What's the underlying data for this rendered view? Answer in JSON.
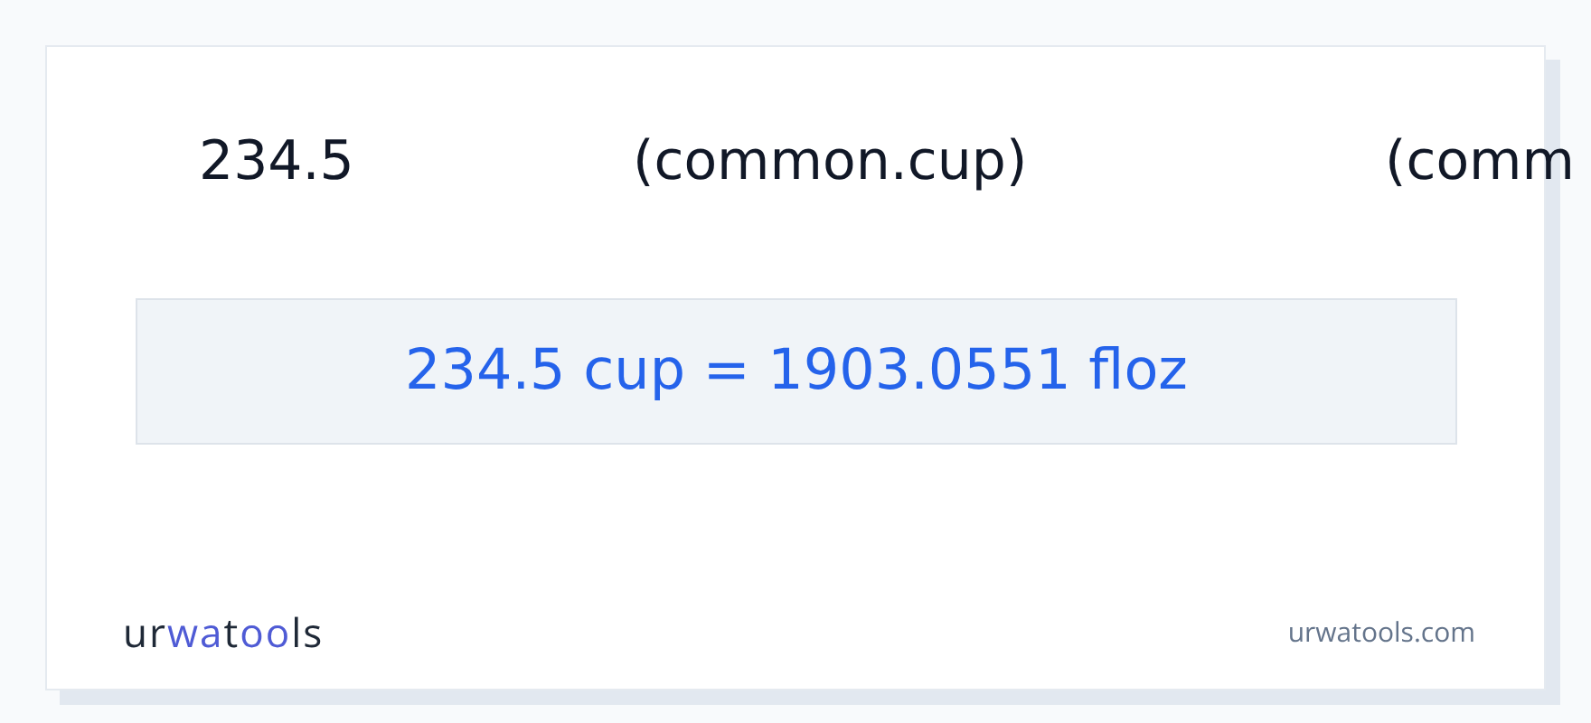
{
  "header_row": [
    "234.5",
    "(common.cup)",
    "(comm"
  ],
  "result": "234.5 cup = 1903.0551 floz",
  "footer": {
    "logo": [
      {
        "text": "ur",
        "accent": false
      },
      {
        "text": "wa",
        "accent": true
      },
      {
        "text": "t",
        "accent": false
      },
      {
        "text": "oo",
        "accent": true
      },
      {
        "text": "ls",
        "accent": false
      }
    ],
    "site": "urwatools.com"
  }
}
